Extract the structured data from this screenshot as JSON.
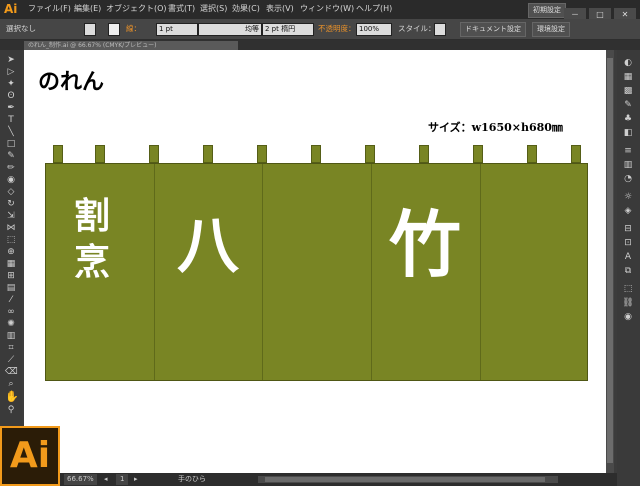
{
  "app": {
    "logo_text": "Ai"
  },
  "menu": {
    "items": [
      "ファイル(F)",
      "編集(E)",
      "オブジェクト(O)",
      "書式(T)",
      "選択(S)",
      "効果(C)",
      "表示(V)",
      "ウィンドウ(W)",
      "ヘルプ(H)"
    ],
    "workspace_label": "初期設定",
    "window_controls": [
      "－",
      "□",
      "✕"
    ]
  },
  "control_bar": {
    "selection_label": "選択なし",
    "stroke_label": "線：",
    "stroke_value": "1 pt",
    "brush_label": "均等",
    "brush_value": "2 pt 楕円",
    "opacity_label": "不透明度：",
    "opacity_value": "100%",
    "style_label": "スタイル：",
    "doc_setup_button": "ドキュメント設定",
    "prefs_button": "環境設定"
  },
  "document_tab": {
    "title": "のれん_制作.ai @ 66.67% (CMYK/プレビュー)"
  },
  "artwork": {
    "title": "のれん",
    "size_label": "サイズ：w1650×h680㎜",
    "vertical_text": [
      "割",
      "烹"
    ],
    "text_1": "八",
    "text_2": "竹"
  },
  "status_bar": {
    "zoom": "66.67%",
    "page": "1",
    "tool_name": "手のひら"
  },
  "colors": {
    "noren_green": "#798524",
    "accent_orange": "#f29a1b",
    "canvas": "#ffffff"
  }
}
